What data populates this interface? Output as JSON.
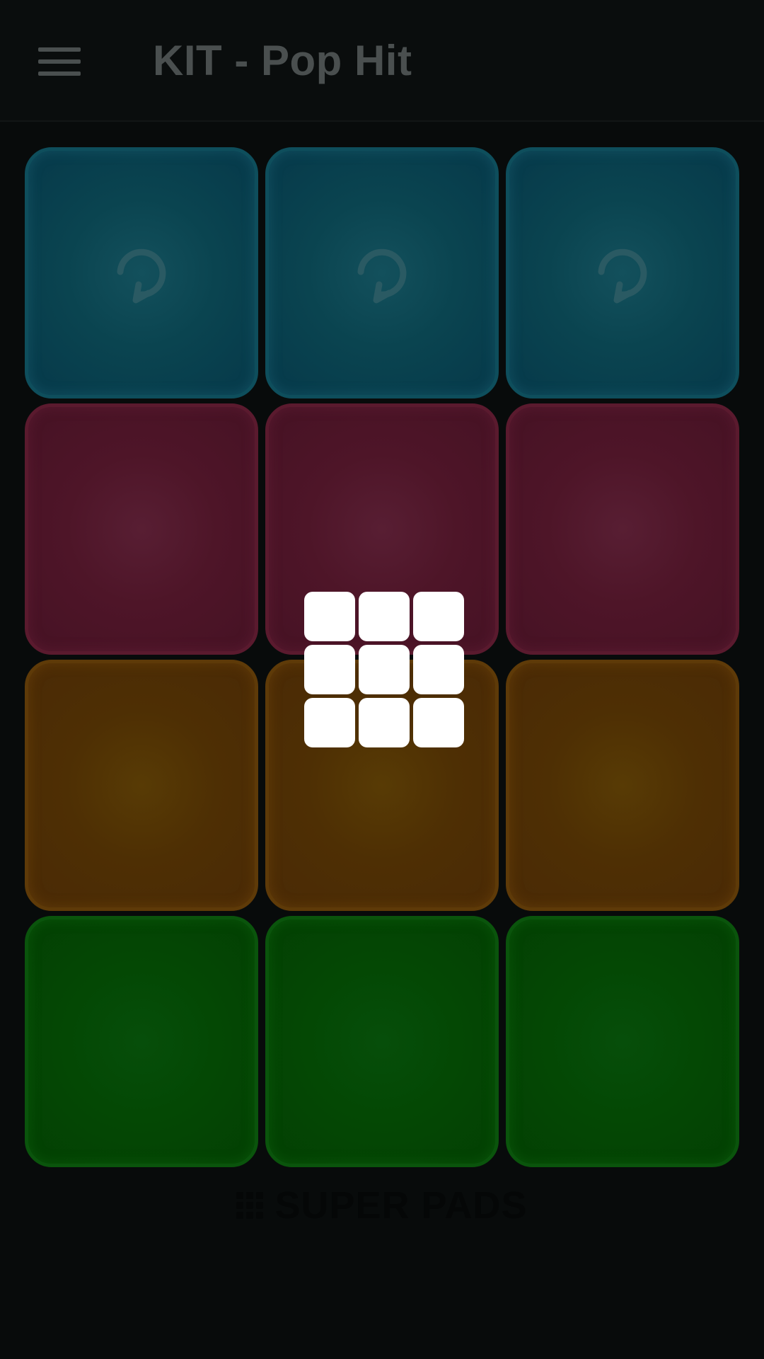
{
  "header": {
    "title": "KIT - Pop Hit",
    "menu_icon": "hamburger-menu-icon"
  },
  "pads": [
    {
      "color": "blue",
      "icon": "loop-icon"
    },
    {
      "color": "blue",
      "icon": "loop-icon"
    },
    {
      "color": "blue",
      "icon": "loop-icon"
    },
    {
      "color": "red",
      "icon": ""
    },
    {
      "color": "red",
      "icon": ""
    },
    {
      "color": "red",
      "icon": ""
    },
    {
      "color": "orange",
      "icon": ""
    },
    {
      "color": "orange",
      "icon": ""
    },
    {
      "color": "orange",
      "icon": ""
    },
    {
      "color": "green",
      "icon": ""
    },
    {
      "color": "green",
      "icon": ""
    },
    {
      "color": "green",
      "icon": ""
    }
  ],
  "colors": {
    "background": "#080b0b",
    "title_text": "#4a4f4f",
    "blue_pad": "#0a4450",
    "red_pad": "#4e1528",
    "orange_pad": "#4e2f04",
    "green_pad": "#044804",
    "overlay_logo": "#ffffff"
  },
  "overlay_logo_icon": "pad-grid-logo-icon",
  "footer": {
    "brand_text": "SUPER PADS",
    "brand_icon": "grid-dots-icon"
  }
}
